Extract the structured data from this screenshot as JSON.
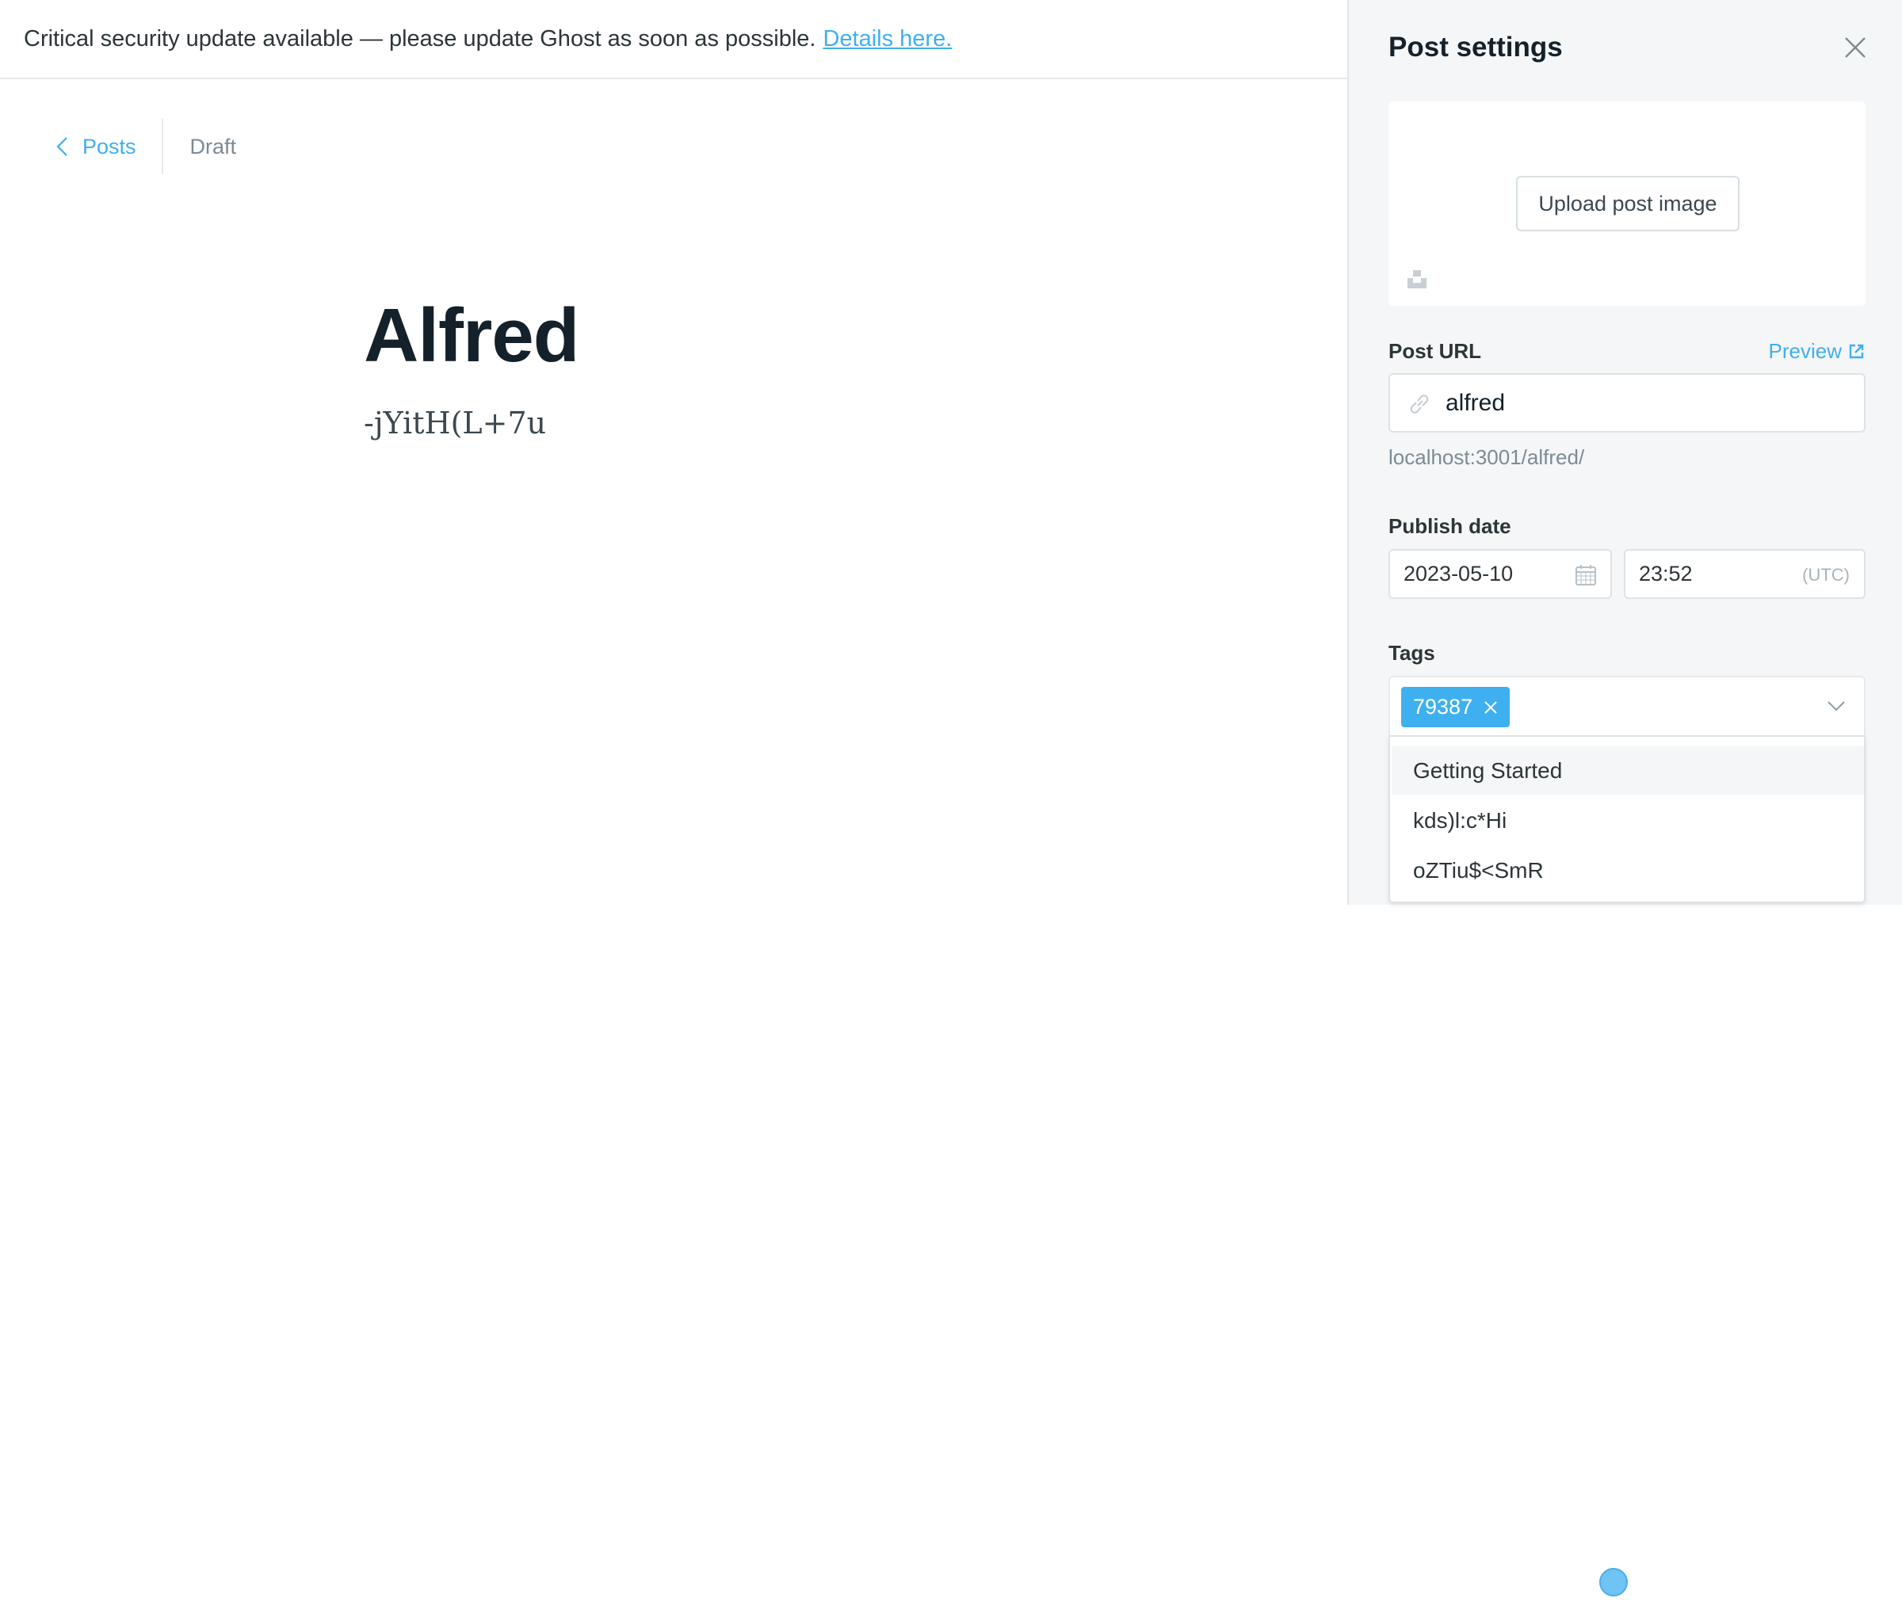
{
  "banner": {
    "message": "Critical security update available — please update Ghost as soon as possible.",
    "link_label": "Details here."
  },
  "breadcrumb": {
    "back_label": "Posts",
    "status": "Draft"
  },
  "post": {
    "title": "Alfred",
    "body": "-jYitH(L+7u"
  },
  "settings": {
    "title": "Post settings",
    "upload_label": "Upload post image",
    "post_url": {
      "label": "Post URL",
      "preview_label": "Preview",
      "value": "alfred",
      "full_url": "localhost:3001/alfred/"
    },
    "publish_date": {
      "label": "Publish date",
      "date": "2023-05-10",
      "time": "23:52",
      "timezone": "(UTC)"
    },
    "tags": {
      "label": "Tags",
      "selected": [
        "79387"
      ],
      "options": [
        "Getting Started",
        "kds)l:c*Hi",
        "oZTiu$<SmR"
      ],
      "highlighted_option": "Getting Started"
    }
  },
  "colors": {
    "accent": "#3eb0ef",
    "text": "#15212a",
    "muted": "#7c8b94",
    "panel_bg": "#f4f6f7"
  },
  "icons": [
    "chevron-left-icon",
    "close-icon",
    "unsplash-icon",
    "external-link-icon",
    "link-icon",
    "calendar-icon",
    "tag-remove-icon",
    "chevron-down-icon"
  ]
}
